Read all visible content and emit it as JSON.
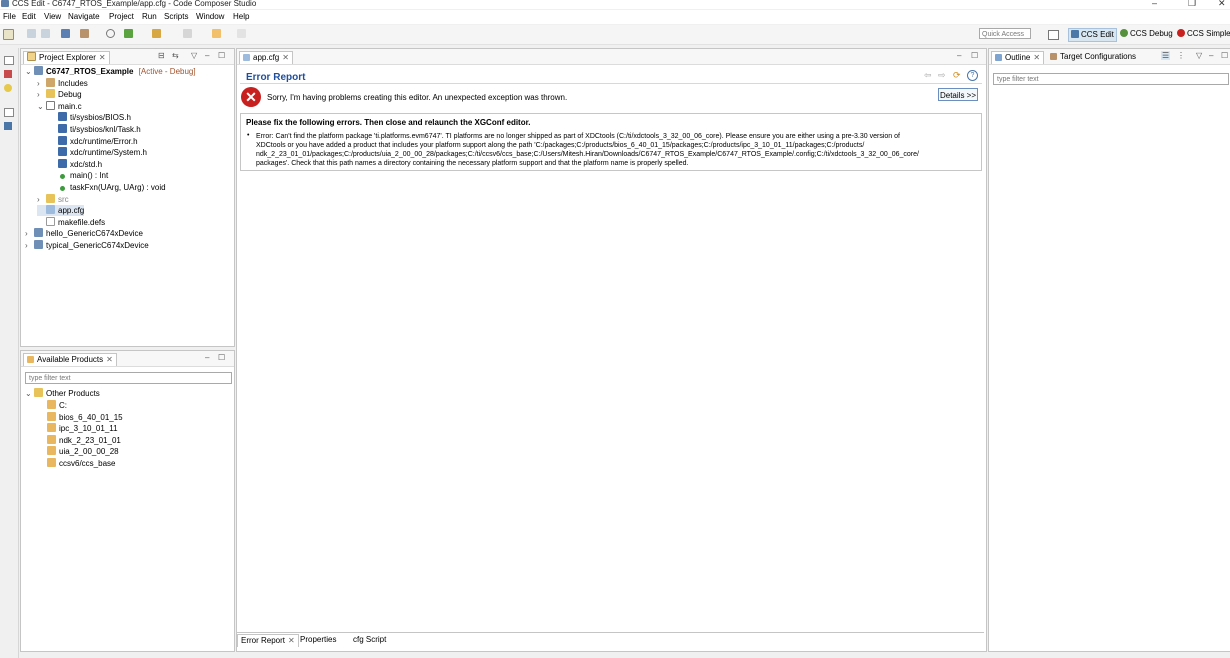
{
  "window": {
    "title": "CCS Edit - C6747_RTOS_Example/app.cfg - Code Composer Studio",
    "controls": [
      "–",
      "❐",
      "✕"
    ]
  },
  "menu": [
    "File",
    "Edit",
    "View",
    "Navigate",
    "Project",
    "Run",
    "Scripts",
    "Window",
    "Help"
  ],
  "toolbar": {
    "quick_access": "Quick Access",
    "perspectives": [
      "CCS Edit",
      "CCS Debug",
      "CCS Simple"
    ]
  },
  "project_explorer": {
    "tab_label": "Project Explorer",
    "items": [
      {
        "label": "C6747_RTOS_Example",
        "suffix": "[Active - Debug]",
        "level": 0,
        "expanded": true,
        "bold": true,
        "icon": "project-icon"
      },
      {
        "label": "Includes",
        "level": 1,
        "expanded": false,
        "icon": "includes-icon"
      },
      {
        "label": "Debug",
        "level": 1,
        "expanded": false,
        "icon": "folder-icon"
      },
      {
        "label": "main.c",
        "level": 1,
        "expanded": true,
        "icon": "c-file-icon"
      },
      {
        "label": "ti/sysbios/BIOS.h",
        "level": 2,
        "icon": "header-include-icon"
      },
      {
        "label": "ti/sysbios/knl/Task.h",
        "level": 2,
        "icon": "header-include-icon"
      },
      {
        "label": "xdc/runtime/Error.h",
        "level": 2,
        "icon": "header-include-icon"
      },
      {
        "label": "xdc/runtime/System.h",
        "level": 2,
        "icon": "header-include-icon"
      },
      {
        "label": "xdc/std.h",
        "level": 2,
        "icon": "header-include-icon"
      },
      {
        "label": "main() : Int",
        "level": 2,
        "icon": "function-icon"
      },
      {
        "label": "taskFxn(UArg, UArg) : void",
        "level": 2,
        "icon": "function-icon"
      },
      {
        "label": "src",
        "level": 1,
        "expanded": false,
        "icon": "folder-icon",
        "muted": true
      },
      {
        "label": "app.cfg",
        "level": 1,
        "icon": "cfg-file-icon",
        "selected": true
      },
      {
        "label": "makefile.defs",
        "level": 1,
        "icon": "file-icon"
      },
      {
        "label": "hello_GenericC674xDevice",
        "level": 0,
        "expanded": false,
        "icon": "project-icon"
      },
      {
        "label": "typical_GenericC674xDevice",
        "level": 0,
        "expanded": false,
        "icon": "project-icon"
      }
    ]
  },
  "available_products": {
    "tab_label": "Available Products",
    "filter_placeholder": "type filter text",
    "root": "Other Products",
    "items": [
      "C:",
      "bios_6_40_01_15",
      "ipc_3_10_01_11",
      "ndk_2_23_01_01",
      "uia_2_00_00_28",
      "ccsv6/ccs_base"
    ]
  },
  "editor": {
    "tab_label": "app.cfg",
    "heading": "Error Report",
    "message": "Sorry, I'm having problems creating this editor. An unexpected exception was thrown.",
    "details_button": "Details >>",
    "fix_heading": "Please fix the following errors. Then close and relaunch the XGConf editor.",
    "error_lines": [
      "Error: Can't find the platform package 'ti.platforms.evm6747'. TI platforms are no longer shipped as part of XDCtools (C:/ti/xdctools_3_32_00_06_core). Please ensure you are either using a pre-3.30 version of",
      "XDCtools or you have added a product that includes your platform support along the path 'C:/packages;C:/products/bios_6_40_01_15/packages;C:/products/ipc_3_10_01_11/packages;C:/products/",
      "ndk_2_23_01_01/packages;C:/products/uia_2_00_00_28/packages;C:/ti/ccsv6/ccs_base;C:/Users/Mitesh.Hiran/Downloads/C6747_RTOS_Example/C6747_RTOS_Example/.config;C:/ti/xdctools_3_32_00_06_core/",
      "packages'. Check that this path names a directory containing the necessary platform support and that the platform name is properly spelled."
    ],
    "bottom_tabs": [
      "Error Report",
      "Properties",
      "cfg Script"
    ]
  },
  "outline": {
    "tabs": [
      "Outline",
      "Target Configurations"
    ],
    "filter_placeholder": "type filter text"
  },
  "colors": {
    "error_red": "#c8201f",
    "active_suffix": "#a0522d",
    "link_blue": "#1f4e9c"
  }
}
